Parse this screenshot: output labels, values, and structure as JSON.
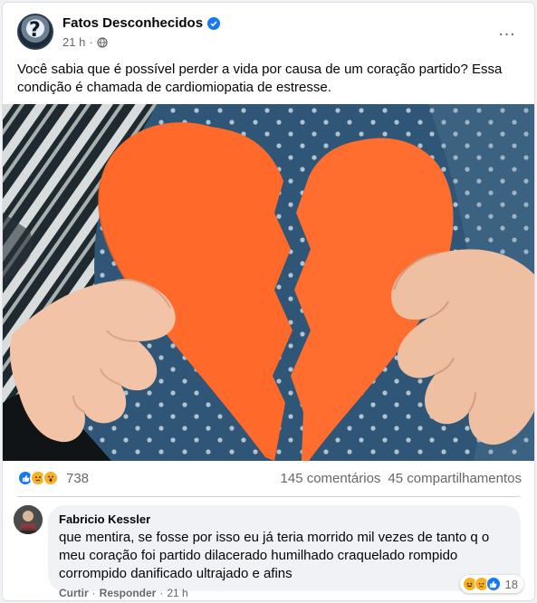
{
  "post": {
    "page_name": "Fatos Desconhecidos",
    "time": "21 h",
    "separator": "·",
    "text": "Você sabia que é possível perder a vida por causa de um coração partido? Essa condição é chamada de cardiomiopatia de estresse.",
    "more_icon": "…"
  },
  "stats": {
    "reactions_count": "738",
    "comments": "145 comentários",
    "shares": "45 compartilhamentos"
  },
  "comment": {
    "author": "Fabricio Kessler",
    "text": "que mentira, se fosse por isso eu já teria morrido mil vezes de tanto q o meu coração foi partido dilacerado humilhado craquelado rompido corrompido danificado ultrajado e afins",
    "reactions_count": "18",
    "actions": {
      "like": "Curtir",
      "reply": "Responder",
      "time": "21 h",
      "dot": "·"
    }
  },
  "colors": {
    "accent": "#1877f2",
    "heart": "#ff6a2a",
    "emoji_yellow": "#f7b125"
  }
}
